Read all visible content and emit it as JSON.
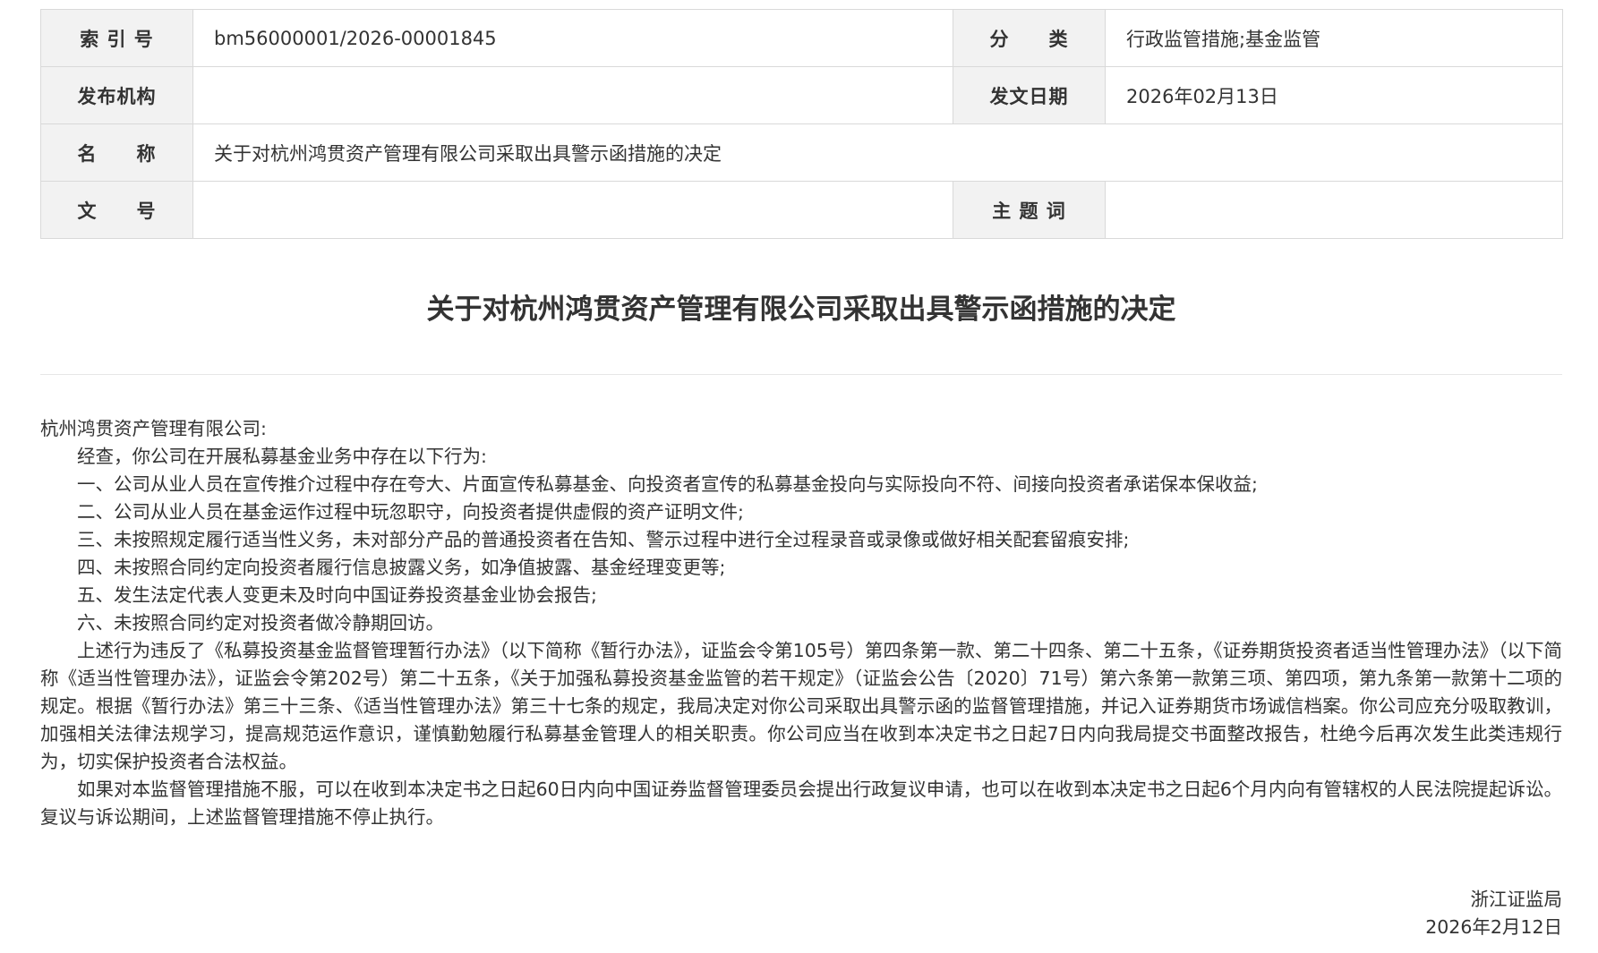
{
  "meta_table": {
    "index_label": "索 引 号",
    "index_value": "bm56000001/2026-00001845",
    "category_label": "分　　类",
    "category_value": "行政监管措施;基金监管",
    "issuer_label": "发布机构",
    "issuer_value": "",
    "date_label": "发文日期",
    "date_value": "2026年02月13日",
    "name_label": "名　　称",
    "name_value": "关于对杭州鸿贯资产管理有限公司采取出具警示函措施的决定",
    "docno_label": "文　　号",
    "docno_value": "",
    "keywords_label": "主 题 词",
    "keywords_value": ""
  },
  "document": {
    "title": "关于对杭州鸿贯资产管理有限公司采取出具警示函措施的决定",
    "addressee": "杭州鸿贯资产管理有限公司:",
    "paragraphs": [
      "经查，你公司在开展私募基金业务中存在以下行为:",
      "一、公司从业人员在宣传推介过程中存在夸大、片面宣传私募基金、向投资者宣传的私募基金投向与实际投向不符、间接向投资者承诺保本保收益;",
      "二、公司从业人员在基金运作过程中玩忽职守，向投资者提供虚假的资产证明文件;",
      "三、未按照规定履行适当性义务，未对部分产品的普通投资者在告知、警示过程中进行全过程录音或录像或做好相关配套留痕安排;",
      "四、未按照合同约定向投资者履行信息披露义务，如净值披露、基金经理变更等;",
      "五、发生法定代表人变更未及时向中国证券投资基金业协会报告;",
      "六、未按照合同约定对投资者做冷静期回访。",
      "上述行为违反了《私募投资基金监督管理暂行办法》（以下简称《暂行办法》，证监会令第105号）第四条第一款、第二十四条、第二十五条，《证券期货投资者适当性管理办法》（以下简称《适当性管理办法》，证监会令第202号）第二十五条，《关于加强私募投资基金监管的若干规定》（证监会公告〔2020〕71号）第六条第一款第三项、第四项，第九条第一款第十二项的规定。根据《暂行办法》第三十三条、《适当性管理办法》第三十七条的规定，我局决定对你公司采取出具警示函的监督管理措施，并记入证券期货市场诚信档案。你公司应充分吸取教训，加强相关法律法规学习，提高规范运作意识，谨慎勤勉履行私募基金管理人的相关职责。你公司应当在收到本决定书之日起7日内向我局提交书面整改报告，杜绝今后再次发生此类违规行为，切实保护投资者合法权益。",
      "如果对本监督管理措施不服，可以在收到本决定书之日起60日内向中国证券监督管理委员会提出行政复议申请，也可以在收到本决定书之日起6个月内向有管辖权的人民法院提起诉讼。复议与诉讼期间，上述监督管理措施不停止执行。"
    ],
    "signature_org": "浙江证监局",
    "signature_date": "2026年2月12日"
  }
}
